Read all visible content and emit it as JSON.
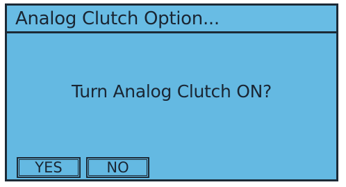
{
  "dialog": {
    "title": "Analog Clutch Option...",
    "message": "Turn Analog Clutch ON?",
    "yes_label": "YES",
    "no_label": "NO"
  },
  "colors": {
    "panel_background": "#64b9e2",
    "border": "#1c2a36",
    "text": "#1a2633"
  }
}
